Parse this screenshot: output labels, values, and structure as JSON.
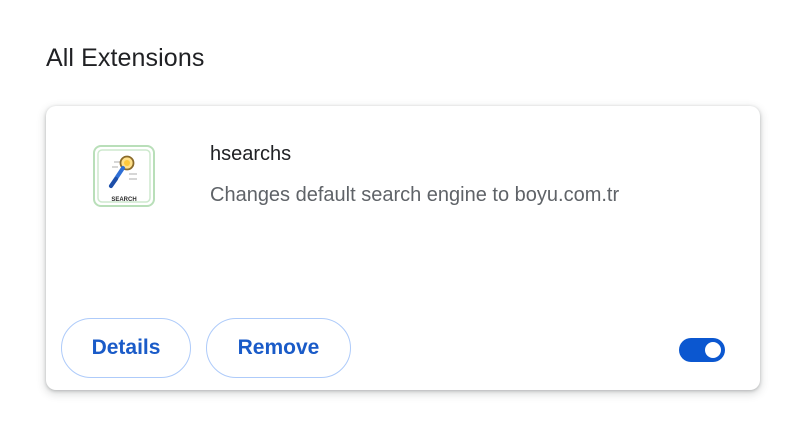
{
  "section": {
    "title": "All Extensions"
  },
  "extension": {
    "name": "hsearchs",
    "description": "Changes default search engine to boyu.com.tr",
    "icon": {
      "name": "search-magnifier-icon",
      "caption": "SEARCH"
    },
    "enabled": true
  },
  "buttons": {
    "details_label": "Details",
    "remove_label": "Remove"
  },
  "colors": {
    "accent": "#0b57d0",
    "button_text": "#1a5bc8",
    "button_border": "#aecbfa"
  }
}
